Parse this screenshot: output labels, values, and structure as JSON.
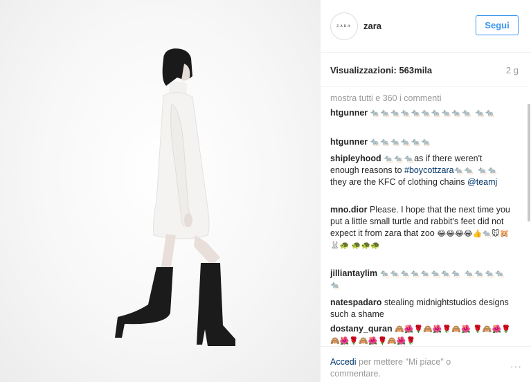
{
  "account": {
    "avatar_text": "ZARA",
    "username": "zara",
    "follow_label": "Segui"
  },
  "stats": {
    "views": "Visualizzazioni: 563mila",
    "age": "2 g"
  },
  "comments": {
    "show_all": "mostra tutti e 360 i commenti",
    "items": [
      {
        "user": "htgunner",
        "parts": []
      },
      {
        "user": "htgunner",
        "parts": []
      },
      {
        "user": "shipleyhood",
        "before": "as if there weren't enough reasons to ",
        "tag1": "#boycottzara",
        "middle": " they are the KFC of clothing chains ",
        "tag2": "@teamj"
      },
      {
        "user": "mno.dior",
        "text": "Please. I hope that the next time you put a little small turtle and rabbit's feet did not expect it from zara that zoo"
      },
      {
        "user": "jilliantaylim"
      },
      {
        "user": "natespadaro",
        "text": "stealing midnightstudios designs such a shame"
      },
      {
        "user": "dostany_quran"
      }
    ]
  },
  "footer": {
    "link": "Accedi",
    "text": " per mettere \"Mi piace\" o commentare.",
    "more_icon": "···"
  },
  "colors": {
    "accent": "#3897f0",
    "link": "#003569",
    "muted": "#999999"
  }
}
